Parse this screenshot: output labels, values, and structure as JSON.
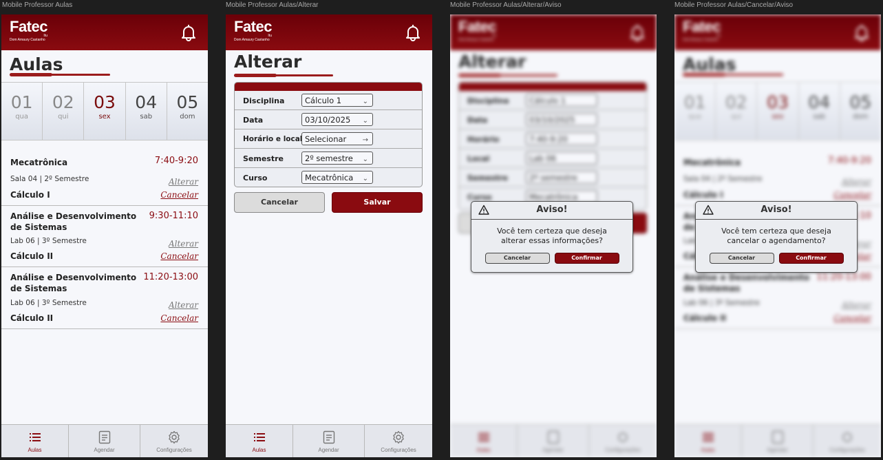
{
  "frames": {
    "f1": "Mobile Professor Aulas",
    "f2": "Mobile Professor Aulas/Alterar",
    "f3": "Mobile Professor Aulas/Alterar/Aviso",
    "f4": "Mobile Professor Aulas/Cancelar/Aviso"
  },
  "header": {
    "logo": "Fatec",
    "logo_sub1": "Itu",
    "logo_sub2": "Dom Amaury Castanho"
  },
  "aulas": {
    "title": "Aulas",
    "days": [
      {
        "num": "01",
        "wd": "qua"
      },
      {
        "num": "02",
        "wd": "qui"
      },
      {
        "num": "03",
        "wd": "sex"
      },
      {
        "num": "04",
        "wd": "sab"
      },
      {
        "num": "05",
        "wd": "dom"
      }
    ],
    "classes": [
      {
        "course": "Mecatrônica",
        "time": "7:40-9:20",
        "room": "Sala 04",
        "sem": "2º Semestre",
        "subject": "Cálculo I",
        "alter": "Alterar",
        "cancel": "Cancelar"
      },
      {
        "course": "Análise e Desenvolvimento",
        "course2": "de Sistemas",
        "time": "9:30-11:10",
        "room": "Lab 06",
        "sem": "3º Semestre",
        "subject": "Cálculo II",
        "alter": "Alterar",
        "cancel": "Cancelar"
      },
      {
        "course": "Análise e Desenvolvimento",
        "course2": "de Sistemas",
        "time": "11:20-13:00",
        "room": "Lab 06",
        "sem": "3º Semestre",
        "subject": "Cálculo II",
        "alter": "Alterar",
        "cancel": "Cancelar"
      }
    ]
  },
  "alterar": {
    "title": "Alterar",
    "rows": [
      {
        "label": "Disciplina",
        "value": "Cálculo 1",
        "chev": "⌄"
      },
      {
        "label": "Data",
        "value": "03/10/2025",
        "chev": "⌄"
      },
      {
        "label": "Horário e local",
        "value": "Selecionar",
        "chev": "→"
      },
      {
        "label": "Semestre",
        "value": "2º semestre",
        "chev": "⌄"
      },
      {
        "label": "Curso",
        "value": "Mecatrônica",
        "chev": "⌄"
      }
    ],
    "cancel": "Cancelar",
    "save": "Salvar"
  },
  "alterar_blur": {
    "rows": [
      {
        "label": "Disciplina",
        "value": "Cálculo 1"
      },
      {
        "label": "Data",
        "value": "03/10/2025"
      },
      {
        "label": "Horário",
        "value": "7:40-9:20"
      },
      {
        "label": "Local",
        "value": "Lab 06"
      },
      {
        "label": "Semestre",
        "value": "2º semestre"
      },
      {
        "label": "Curso",
        "value": "Mecatrônica"
      }
    ]
  },
  "dialog_alter": {
    "title": "Aviso!",
    "line1": "Você tem certeza que deseja",
    "line2": "alterar essas informações?",
    "cancel": "Cancelar",
    "confirm": "Confirmar"
  },
  "dialog_cancel": {
    "title": "Aviso!",
    "line1": "Você tem certeza que deseja",
    "line2": "cancelar o agendamento?",
    "cancel": "Cancelar",
    "confirm": "Confirmar"
  },
  "nav": {
    "aulas": "Aulas",
    "agendar": "Agendar",
    "config": "Configurações"
  },
  "colors": {
    "brand": "#8a0b10",
    "bg": "#f6f7fb"
  }
}
